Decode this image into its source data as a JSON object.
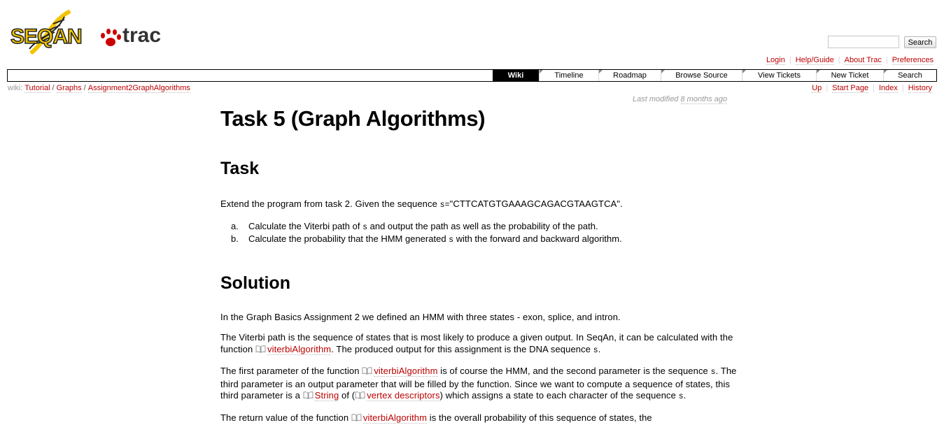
{
  "logo": {
    "left": "SEQAN",
    "right": "trac"
  },
  "search": {
    "placeholder": "",
    "button_label": "Search"
  },
  "metanav": [
    {
      "label": "Login"
    },
    {
      "label": "Help/Guide"
    },
    {
      "label": "About Trac"
    },
    {
      "label": "Preferences"
    }
  ],
  "mainnav": [
    {
      "label": "Wiki",
      "active": true
    },
    {
      "label": "Timeline"
    },
    {
      "label": "Roadmap"
    },
    {
      "label": "Browse Source"
    },
    {
      "label": "View Tickets"
    },
    {
      "label": "New Ticket"
    },
    {
      "label": "Search"
    }
  ],
  "breadcrumb": {
    "prefix": "wiki:",
    "items": [
      "Tutorial",
      "Graphs",
      "Assignment2GraphAlgorithms"
    ]
  },
  "ctxtnav": [
    {
      "label": "Up"
    },
    {
      "label": "Start Page"
    },
    {
      "label": "Index"
    },
    {
      "label": "History"
    }
  ],
  "lastmod": {
    "prefix": "Last modified",
    "age": "8 months ago"
  },
  "page": {
    "title": "Task 5 (Graph Algorithms)",
    "task_heading": "Task",
    "task_intro_pre": "Extend the program from task 2. Given the sequence ",
    "task_intro_code": "s=",
    "task_intro_seq": "\"CTTCATGTGAAAGCAGACGTAAGTCA\".",
    "list": [
      {
        "marker": "a.",
        "pre": "Calculate the Viterbi path of ",
        "code": "s",
        "post": " and output the path as well as the probability of the path."
      },
      {
        "marker": "b.",
        "pre": "Calculate the probability that the HMM generated ",
        "code": "s",
        "post": " with the forward and backward algorithm."
      }
    ],
    "solution_heading": "Solution",
    "sol_p1": "In the Graph Basics Assignment 2 we defined an HMM with three states - exon, splice, and intron.",
    "sol_p2_a": "The Viterbi path is the sequence of states that is most likely to produce a given output. In SeqAn, it can be calculated with the function ",
    "sol_p2_link": "viterbiAlgorithm",
    "sol_p2_b": ". The produced output for this assignment is the DNA sequence ",
    "sol_p2_code": "s",
    "sol_p2_c": ".",
    "sol_p3_a": "The first parameter of the function ",
    "sol_p3_link1": "viterbiAlgorithm",
    "sol_p3_b": " is of course the HMM, and the second parameter is the sequence ",
    "sol_p3_code1": "s",
    "sol_p3_c": ". The third parameter is an output parameter that will be filled by the function. Since we want to compute a sequence of states, this third parameter is a ",
    "sol_p3_link2": "String",
    "sol_p3_d": " of (",
    "sol_p3_link3": "vertex descriptors",
    "sol_p3_e": ") which assigns a state to each character of the sequence ",
    "sol_p3_code2": "s",
    "sol_p3_f": ".",
    "sol_p4_a": "The return value of the function ",
    "sol_p4_link": "viterbiAlgorithm",
    "sol_p4_b": " is the overall probability of this sequence of states, the"
  },
  "colors": {
    "link": "#bb0000",
    "nav_active_bg": "#000000",
    "muted": "#999999",
    "logo_red": "#cc0000",
    "logo_yellow": "#f2c400"
  }
}
